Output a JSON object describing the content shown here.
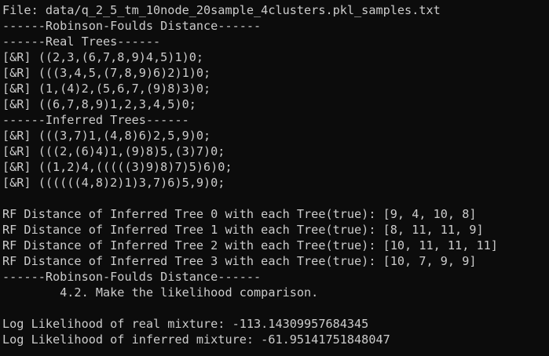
{
  "terminal": {
    "background": "#0c0c0c",
    "foreground": "#cccccc",
    "lines": [
      "File: data/q_2_5_tm_10node_20sample_4clusters.pkl_samples.txt",
      "------Robinson-Foulds Distance------",
      "------Real Trees------",
      "[&R] ((2,3,(6,7,8,9)4,5)1)0;",
      "[&R] (((3,4,5,(7,8,9)6)2)1)0;",
      "[&R] (1,(4)2,(5,6,7,(9)8)3)0;",
      "[&R] ((6,7,8,9)1,2,3,4,5)0;",
      "------Inferred Trees------",
      "[&R] (((3,7)1,(4,8)6)2,5,9)0;",
      "[&R] (((2,(6)4)1,(9)8)5,(3)7)0;",
      "[&R] ((1,2)4,(((((3)9)8)7)5)6)0;",
      "[&R] ((((((4,8)2)1)3,7)6)5,9)0;",
      "",
      "RF Distance of Inferred Tree 0 with each Tree(true): [9, 4, 10, 8]",
      "RF Distance of Inferred Tree 1 with each Tree(true): [8, 11, 11, 9]",
      "RF Distance of Inferred Tree 2 with each Tree(true): [10, 11, 11, 11]",
      "RF Distance of Inferred Tree 3 with each Tree(true): [10, 7, 9, 9]",
      "------Robinson-Foulds Distance------",
      "        4.2. Make the likelihood comparison.",
      "",
      "Log Likelihood of real mixture: -113.14309957684345",
      "Log Likelihood of inferred mixture: -61.95141751848047"
    ]
  }
}
